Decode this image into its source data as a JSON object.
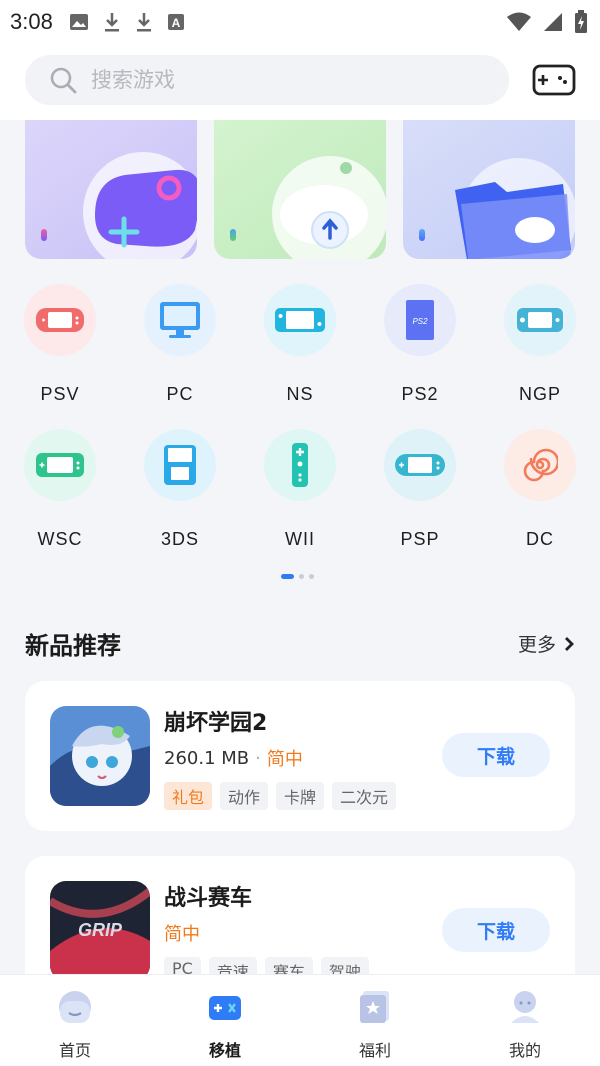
{
  "status_bar": {
    "time": "3:08"
  },
  "search": {
    "placeholder": "搜索游戏"
  },
  "banners": [
    {
      "name": "add-game",
      "accent": "#7b5cf6"
    },
    {
      "name": "cloud-upload",
      "accent": "#5ccf6a"
    },
    {
      "name": "cloud-folder",
      "accent": "#4b6ff6"
    }
  ],
  "platforms": [
    {
      "label": "PSV",
      "bg": "#fde9ea",
      "icon_color": "#f26b6b"
    },
    {
      "label": "PC",
      "bg": "#e5f1fd",
      "icon_color": "#3a9bf0"
    },
    {
      "label": "NS",
      "bg": "#dff4fb",
      "icon_color": "#22b6de"
    },
    {
      "label": "PS2",
      "bg": "#e7eafb",
      "icon_color": "#5d72f2"
    },
    {
      "label": "NGP",
      "bg": "#e3f3fa",
      "icon_color": "#44b3d6"
    },
    {
      "label": "WSC",
      "bg": "#e1f7ef",
      "icon_color": "#2ec48c"
    },
    {
      "label": "3DS",
      "bg": "#dff3fd",
      "icon_color": "#2aa8e8"
    },
    {
      "label": "WII",
      "bg": "#dff7f4",
      "icon_color": "#22c3b1"
    },
    {
      "label": "PSP",
      "bg": "#dff2f7",
      "icon_color": "#37b6cf"
    },
    {
      "label": "DC",
      "bg": "#fdebe6",
      "icon_color": "#f37a5a"
    }
  ],
  "section": {
    "title": "新品推荐",
    "more": "更多"
  },
  "games": [
    {
      "name": "崩坏学园2",
      "size": "260.1 MB",
      "language": "简中",
      "tags": [
        "礼包",
        "动作",
        "卡牌",
        "二次元"
      ],
      "download": "下载"
    },
    {
      "name": "战斗赛车",
      "size": "",
      "language": "简中",
      "tags": [
        "PC",
        "竞速",
        "赛车",
        "驾驶"
      ],
      "download": "下载"
    }
  ],
  "bottom_nav": [
    {
      "label": "首页",
      "active": false
    },
    {
      "label": "移植",
      "active": true
    },
    {
      "label": "福利",
      "active": false
    },
    {
      "label": "我的",
      "active": false
    }
  ],
  "colors": {
    "accent": "#2f7cf6",
    "orange": "#f07b1e"
  }
}
